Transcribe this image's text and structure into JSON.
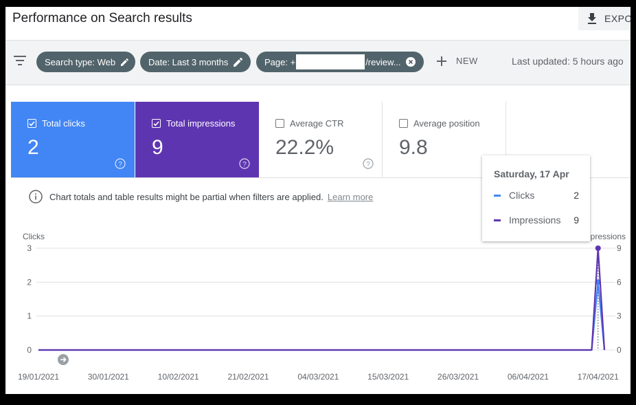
{
  "header": {
    "title": "Performance on Search results",
    "export_label": "EXPO"
  },
  "filters": {
    "chips": [
      {
        "label": "Search type: Web"
      },
      {
        "label": "Date: Last 3 months"
      },
      {
        "label_prefix": "Page: +",
        "label_suffix": "/review..."
      }
    ],
    "new_label": "NEW",
    "last_updated": "Last updated: 5 hours ago"
  },
  "metrics": [
    {
      "label": "Total clicks",
      "value": "2",
      "checked": true,
      "color": "#4285f4"
    },
    {
      "label": "Total impressions",
      "value": "9",
      "checked": true,
      "color": "#5e35b1"
    },
    {
      "label": "Average CTR",
      "value": "22.2%",
      "checked": false
    },
    {
      "label": "Average position",
      "value": "9.8",
      "checked": false
    }
  ],
  "notice": {
    "text": "Chart totals and table results might be partial when filters are applied.",
    "link": "Learn more"
  },
  "tooltip": {
    "date": "Saturday, 17 Apr",
    "rows": [
      {
        "name": "Clicks",
        "value": "2",
        "color": "#4285f4"
      },
      {
        "name": "Impressions",
        "value": "9",
        "color": "#5e35b1"
      }
    ]
  },
  "chart_data": {
    "type": "line",
    "y_left_label": "Clicks",
    "y_right_label": "Impressions",
    "y_left_ticks": [
      "3",
      "2",
      "1",
      "0"
    ],
    "y_right_ticks": [
      "9",
      "6",
      "3",
      "0"
    ],
    "y_left_range": [
      0,
      3
    ],
    "y_right_range": [
      0,
      9
    ],
    "x_tick_labels": [
      "19/01/2021",
      "30/01/2021",
      "10/02/2021",
      "21/02/2021",
      "04/03/2021",
      "15/03/2021",
      "26/03/2021",
      "06/04/2021",
      "17/04/2021"
    ],
    "x_range": [
      "19/01/2021",
      "18/04/2021"
    ],
    "series": [
      {
        "name": "Clicks",
        "color": "#4285f4",
        "axis": "left",
        "points": [
          [
            "19/01/2021",
            0
          ],
          [
            "16/04/2021",
            0
          ],
          [
            "17/04/2021",
            2
          ],
          [
            "18/04/2021",
            0
          ]
        ]
      },
      {
        "name": "Impressions",
        "color": "#5e35b1",
        "axis": "right",
        "points": [
          [
            "19/01/2021",
            0
          ],
          [
            "16/04/2021",
            0
          ],
          [
            "17/04/2021",
            9
          ],
          [
            "18/04/2021",
            0
          ]
        ]
      }
    ],
    "grid": true
  }
}
